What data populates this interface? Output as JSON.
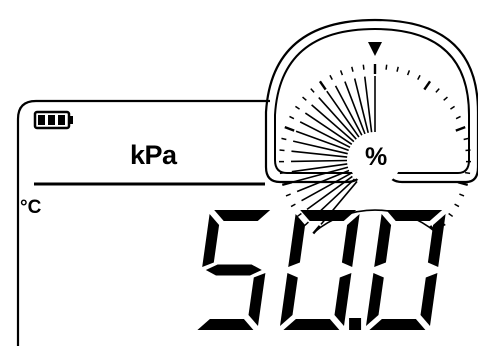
{
  "display": {
    "value": "50.0",
    "unit": "kPa",
    "temp_unit": "°C",
    "gauge_label": "%"
  },
  "gauge": {
    "level_percent": 50,
    "pointer_percent": 50,
    "pointer_icon": "triangle-down-icon"
  },
  "battery": {
    "level_bars": 3,
    "max_bars": 3,
    "icon": "battery-full-icon"
  },
  "colors": {
    "segment": "#000000",
    "background": "#ffffff"
  }
}
